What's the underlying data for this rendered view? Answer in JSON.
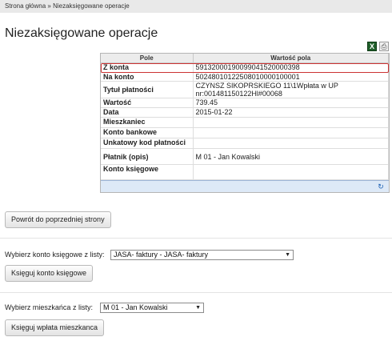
{
  "breadcrumb": {
    "home": "Strona główna",
    "sep": "»",
    "current": "Niezaksięgowane operacje"
  },
  "page_title": "Niezaksięgowane operacje",
  "icons": {
    "excel": "excel-export-icon",
    "print": "print-icon",
    "refresh": "refresh-icon"
  },
  "grid": {
    "headers": {
      "field": "Pole",
      "value": "Wartość pola"
    },
    "rows": [
      {
        "label": "Z konta",
        "value": "59132000190099041520000398"
      },
      {
        "label": "Na konto",
        "value": "50248010122508010000100001"
      },
      {
        "label": "Tytuł płatności",
        "value": "CZYNSZ SIKOPRSKIEGO 11\\1Wpłata w UP nr:001481150122Hl#00068"
      },
      {
        "label": "Wartość",
        "value": "739.45"
      },
      {
        "label": "Data",
        "value": "2015-01-22"
      },
      {
        "label": "Mieszkaniec",
        "value": ""
      },
      {
        "label": "Konto bankowe",
        "value": ""
      },
      {
        "label": "Unkatowy kod płatności",
        "value": ""
      },
      {
        "label": "Płatnik (opis)",
        "value": "M 01 - Jan Kowalski"
      },
      {
        "label": "Konto księgowe",
        "value": ""
      }
    ]
  },
  "back_button": "Powrót do poprzedniej strony",
  "account_section": {
    "label": "Wybierz konto księgowe z listy:",
    "selected": "JASA- faktury - JASA- faktury",
    "button": "Księguj konto księgowe"
  },
  "resident_section": {
    "label": "Wybierz mieszkańca z listy:",
    "selected": "M 01 - Jan Kowalski",
    "button": "Księguj wpłata mieszkanca"
  }
}
